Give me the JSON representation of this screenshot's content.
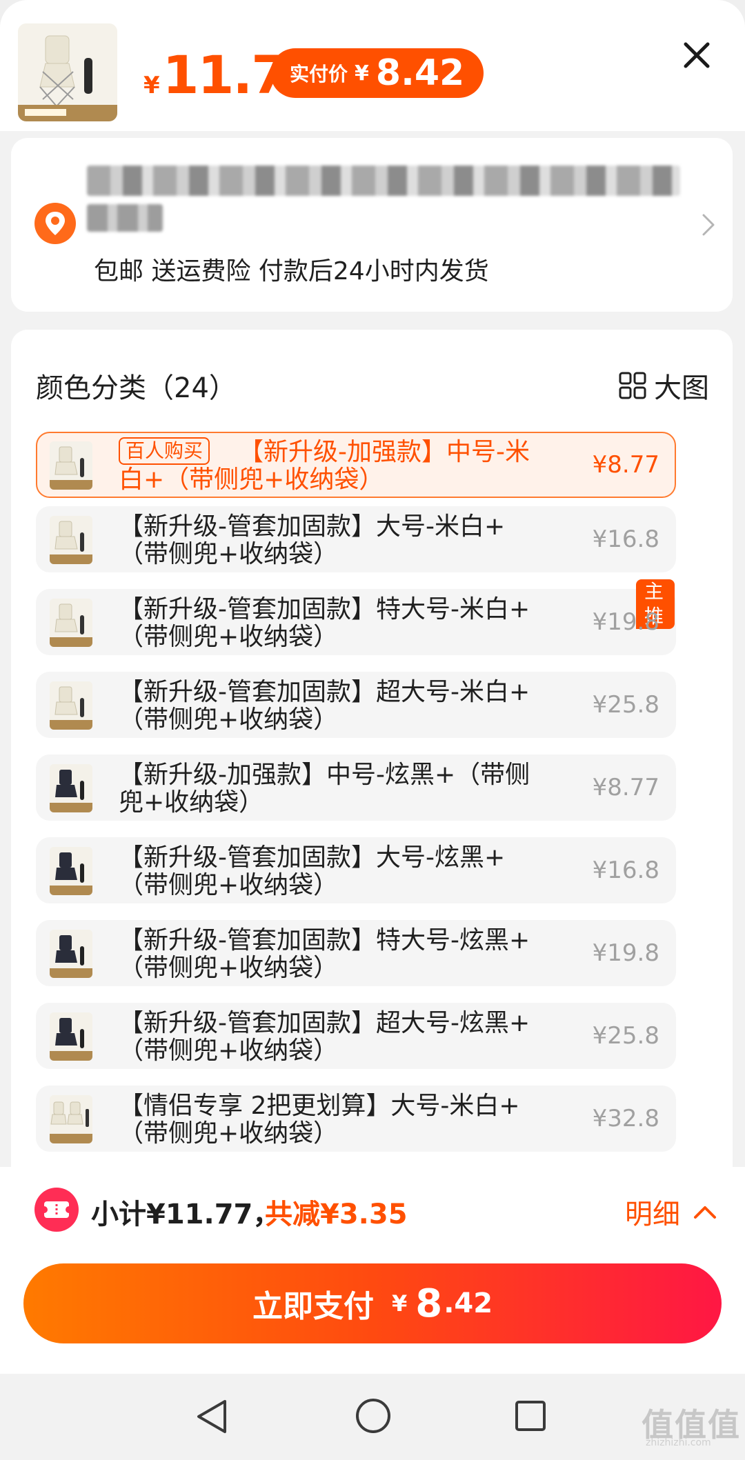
{
  "header": {
    "price_yen": "¥",
    "price": "11.77",
    "pay_label": "实付价",
    "pay_yen": "¥",
    "pay_price": "8.42",
    "close_icon": "close-icon"
  },
  "address": {
    "shipping_info": "包邮 送运费险 付款后24小时内发货",
    "location_icon": "location-pin-icon"
  },
  "variants": {
    "title": "颜色分类（24）",
    "big_image_label": "大图",
    "items": [
      {
        "badge": "百人购买",
        "name": "【新升级-加强款】中号-米白+（带侧兜+收纳袋）",
        "price": "¥8.77"
      },
      {
        "name": "【新升级-管套加固款】大号-米白+（带侧兜+收纳袋）",
        "price": "¥16.8"
      },
      {
        "name": "【新升级-管套加固款】特大号-米白+（带侧兜+收纳袋）",
        "price": "¥19.8",
        "tag": "主推"
      },
      {
        "name": "【新升级-管套加固款】超大号-米白+（带侧兜+收纳袋）",
        "price": "¥25.8"
      },
      {
        "name": "【新升级-加强款】中号-炫黑+（带侧兜+收纳袋）",
        "price": "¥8.77"
      },
      {
        "name": "【新升级-管套加固款】大号-炫黑+（带侧兜+收纳袋）",
        "price": "¥16.8"
      },
      {
        "name": "【新升级-管套加固款】特大号-炫黑+（带侧兜+收纳袋）",
        "price": "¥19.8"
      },
      {
        "name": "【新升级-管套加固款】超大号-炫黑+（带侧兜+收纳袋）",
        "price": "¥25.8"
      },
      {
        "name": "【情侣专享 2把更划算】大号-米白+（带侧兜+收纳袋）",
        "price": "¥32.8"
      }
    ]
  },
  "footer": {
    "subtotal": "小计¥11.77，",
    "discount": "共减¥3.35",
    "detail_label": "明细",
    "pay_button_label": "立即支付",
    "pay_button_yen": "¥",
    "pay_button_int": "8",
    "pay_button_dec": ".42"
  },
  "watermark": {
    "text": "值值值",
    "sub": "zhizhizhi.com"
  },
  "colors": {
    "accent": "#ff5000",
    "selected_bg": "#fff2ea",
    "price_muted": "#a0a0a0"
  }
}
